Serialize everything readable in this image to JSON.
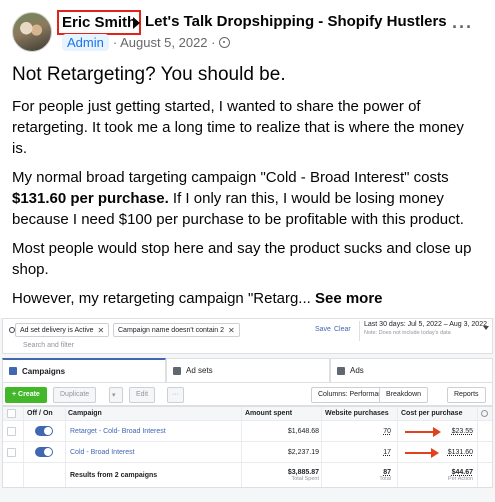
{
  "post": {
    "author": "Eric Smith",
    "group": "Let's Talk Dropshipping - Shopify Hustlers",
    "badge": "Admin",
    "date": "· August 5, 2022 ·",
    "title": "Not Retargeting? You should be.",
    "paragraphs": {
      "p1": "For people just getting started, I wanted to share the power of retargeting. It took me a long time to realize that is where the money is.",
      "p2_a": "My normal broad targeting campaign \"Cold - Broad Interest\" costs ",
      "p2_bold": "$131.60 per purchase.",
      "p2_b": " If I only ran this, I would be losing money because I need $100 per purchase to be profitable with this product.",
      "p3": "Most people would stop here and say the product sucks and close up shop.",
      "p4": "However, my retargeting campaign \"Retarg... "
    },
    "see_more": "See more",
    "icons": {
      "more": "more-options-icon",
      "privacy": "globe-icon",
      "arrow": "arrow-right-icon"
    },
    "highlight_color": "#e0241b"
  },
  "ads": {
    "filters": {
      "chip1": "Ad set delivery is Active",
      "chip2": "Campaign name doesn't contain 2",
      "search_placeholder": "Search and filter",
      "save": "Save",
      "clear": "Clear",
      "date_range": "Last 30 days: Jul 5, 2022 – Aug 3, 2022",
      "date_note": "Note: Does not include today's data"
    },
    "tabs": {
      "campaigns": "Campaigns",
      "ad_sets": "Ad sets",
      "ads": "Ads"
    },
    "toolbar": {
      "create": "+ Create",
      "duplicate": "Duplicate",
      "edit": "Edit",
      "columns": "Columns: Performance",
      "breakdown": "Breakdown",
      "reports": "Reports"
    },
    "table": {
      "headers": {
        "off_on": "Off / On",
        "campaign": "Campaign",
        "amount_spent": "Amount spent",
        "website_purchases": "Website purchases",
        "cost_per_purchase": "Cost per purchase"
      },
      "rows": [
        {
          "campaign": "Retarget - Cold- Broad Interest",
          "amount_spent": "$1,648.68",
          "purchases": "70",
          "cost": "$23.55",
          "toggle_on": true
        },
        {
          "campaign": "Cold - Broad Interest",
          "amount_spent": "$2,237.19",
          "purchases": "17",
          "cost": "$131.60",
          "toggle_on": true
        }
      ],
      "totals": {
        "label": "Results from 2 campaigns",
        "amount_spent": "$3,885.87",
        "amount_sub": "Total Spent",
        "purchases": "87",
        "purchases_sub": "Total",
        "cost": "$44.67",
        "cost_sub": "Per Action"
      }
    },
    "colors": {
      "create_green": "#42b72a",
      "link_blue": "#4267b2",
      "annotation_arrow": "#e0421b"
    }
  }
}
